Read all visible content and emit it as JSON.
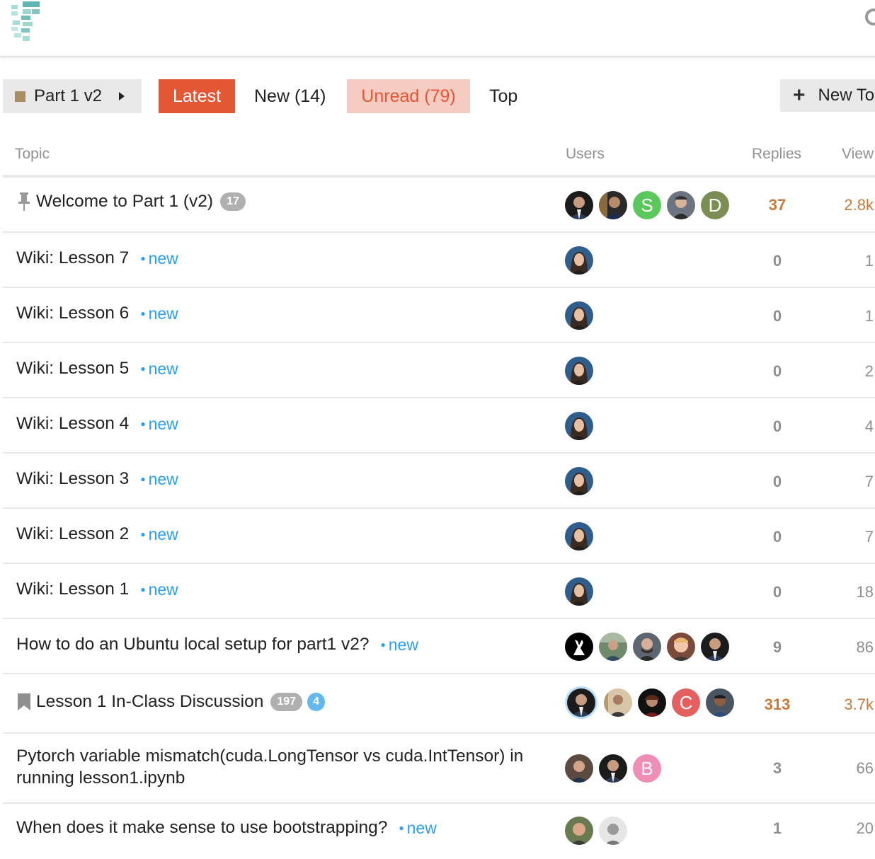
{
  "nav": {
    "category": {
      "label": "Part 1 v2",
      "color": "#a98d62"
    },
    "latest": {
      "label": "Latest",
      "bg": "#e45735"
    },
    "new": {
      "label": "New (14)"
    },
    "unread": {
      "label": "Unread (79)",
      "bg": "#f6cbc1",
      "color": "#e45735"
    },
    "top": {
      "label": "Top"
    },
    "new_topic": {
      "label": "New To"
    }
  },
  "table": {
    "headers": {
      "topic": "Topic",
      "users": "Users",
      "replies": "Replies",
      "views": "View"
    },
    "rows": [
      {
        "title": "Welcome to Part 1 (v2)",
        "icon": "pin-icon",
        "badge": "17",
        "replies": "37",
        "views": "2.8k"
      },
      {
        "title": "Wiki: Lesson 7",
        "new": "new",
        "replies": "0",
        "views": "1"
      },
      {
        "title": "Wiki: Lesson 6",
        "new": "new",
        "replies": "0",
        "views": "1"
      },
      {
        "title": "Wiki: Lesson 5",
        "new": "new",
        "replies": "0",
        "views": "2"
      },
      {
        "title": "Wiki: Lesson 4",
        "new": "new",
        "replies": "0",
        "views": "4"
      },
      {
        "title": "Wiki: Lesson 3",
        "new": "new",
        "replies": "0",
        "views": "7"
      },
      {
        "title": "Wiki: Lesson 2",
        "new": "new",
        "replies": "0",
        "views": "7"
      },
      {
        "title": "Wiki: Lesson 1",
        "new": "new",
        "replies": "0",
        "views": "18"
      },
      {
        "title": "How to do an Ubuntu local setup for part1 v2?",
        "new": "new",
        "replies": "9",
        "views": "86"
      },
      {
        "title": "Lesson 1 In-Class Discussion",
        "icon": "bookmark-icon",
        "badge": "197",
        "badge2": "4",
        "replies": "313",
        "views": "3.7k"
      },
      {
        "title": "Pytorch variable mismatch(cuda.LongTensor vs cuda.IntTensor) in running lesson1.ipynb",
        "replies": "3",
        "views": "66"
      },
      {
        "title": "When does it make sense to use bootstrapping?",
        "new": "new",
        "replies": "1",
        "views": "20"
      }
    ]
  },
  "avatars": {
    "s": {
      "letter": "S",
      "color": "#5bc85b"
    },
    "d": {
      "letter": "D",
      "color": "#7b8f54"
    },
    "c": {
      "letter": "C",
      "color": "#e46060"
    },
    "b": {
      "letter": "B",
      "color": "#ef8fb8"
    }
  },
  "colors": {
    "hot": "#c97a3b",
    "new": "#2b9ef0"
  }
}
